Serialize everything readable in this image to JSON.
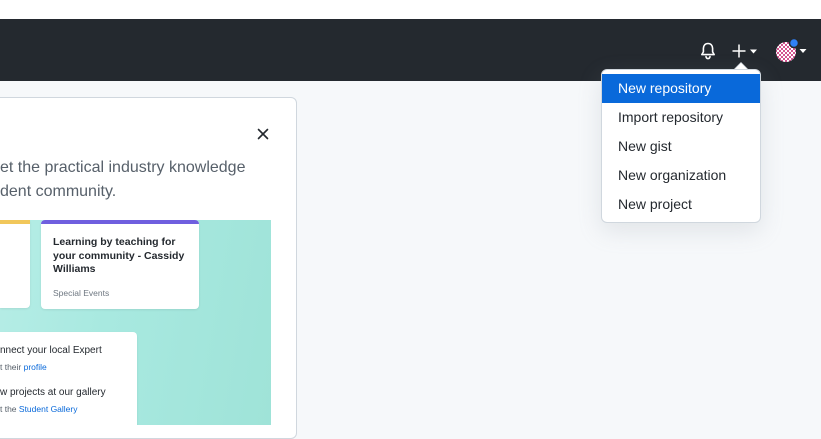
{
  "header": {
    "icons": [
      "bell-icon",
      "plus-icon",
      "caret-down-icon",
      "avatar"
    ]
  },
  "create_menu": {
    "items": [
      {
        "label": "New repository",
        "active": true
      },
      {
        "label": "Import repository"
      },
      {
        "label": "New gist"
      },
      {
        "label": "New organization"
      },
      {
        "label": "New project"
      }
    ]
  },
  "promo": {
    "close_icon": "close-icon",
    "intro_line1": "et the practical industry knowledge",
    "intro_line2": "dent community.",
    "event_card": {
      "title": "Learning by teaching for your community - Cassidy Williams",
      "tag": "Special Events"
    },
    "gallery": {
      "line1": "nnect your local Expert",
      "line2_prefix": "t their ",
      "line2_link": "profile",
      "line3": "w projects at our gallery",
      "line4_prefix": "t the ",
      "line4_link": "Student Gallery"
    }
  },
  "colors": {
    "header_bg": "#24292f",
    "page_bg": "#f6f8fa",
    "accent": "#0969da",
    "notification_dot": "#2f81f7"
  }
}
